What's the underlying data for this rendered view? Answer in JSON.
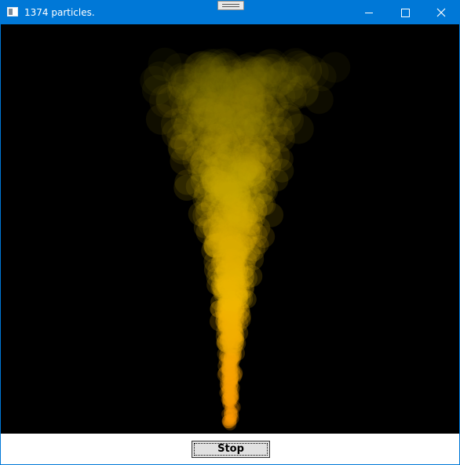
{
  "window": {
    "title": "1374 particles.",
    "accent_color": "#0078d7"
  },
  "titlebar_buttons": {
    "minimize_icon": "minimize-icon",
    "maximize_icon": "maximize-icon",
    "close_icon": "close-icon"
  },
  "canvas": {
    "background": "#000000",
    "particle_count": 1374,
    "plume_colors": [
      "#ff9a00",
      "#f2b800",
      "#c9a800",
      "#8a7a00"
    ]
  },
  "footer": {
    "stop_label": "Stop"
  }
}
